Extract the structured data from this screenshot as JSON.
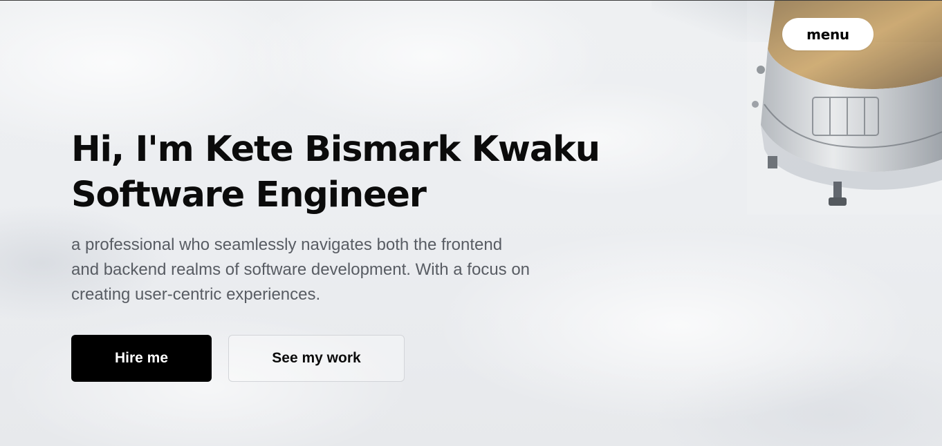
{
  "nav": {
    "menu_label": "menu"
  },
  "hero": {
    "headline_line1": "Hi, I'm Kete Bismark Kwaku",
    "headline_line2": "Software Engineer",
    "description_lines": [
      "a professional who seamlessly navigates both the frontend",
      "and backend realms of software development. With a focus on",
      "creating user-centric experiences."
    ],
    "primary_cta": "Hire me",
    "secondary_cta": "See my work"
  },
  "background": {
    "image_subject": "earth-clouds-from-orbit-with-satellite"
  },
  "colors": {
    "primary_button": "#000000",
    "primary_button_text": "#ffffff",
    "headline": "#0b0b0b",
    "body_text": "#585c63"
  }
}
